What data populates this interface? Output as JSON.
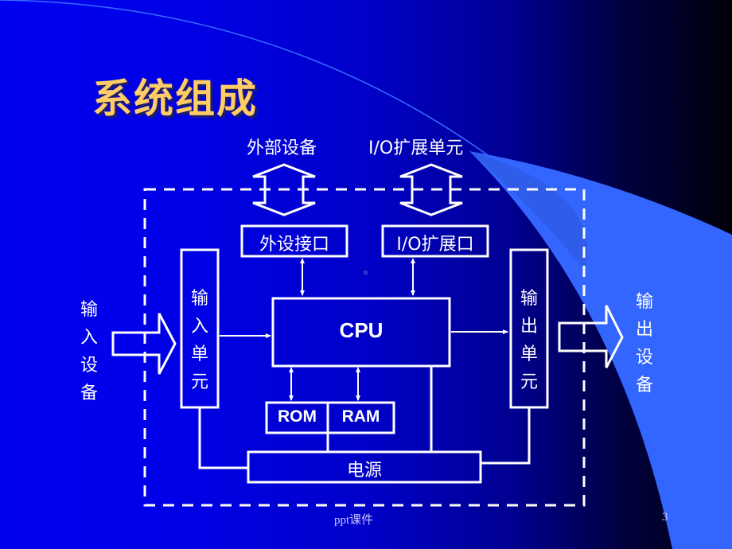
{
  "slide": {
    "title": "系统组成",
    "footer": "ppt课件",
    "page_number": "3",
    "colors": {
      "title": "#ffcc66",
      "line": "#ffffff",
      "accent_shape": "#3366ff"
    }
  },
  "diagram": {
    "top_labels": {
      "peripheral": "外部设备",
      "io_expansion_unit": "I/O扩展单元"
    },
    "boxes": {
      "peripheral_interface": "外设接口",
      "io_expansion_port": "I/O扩展口",
      "cpu": "CPU",
      "rom": "ROM",
      "ram": "RAM",
      "power": "电源",
      "input_unit": [
        "输",
        "入",
        "单",
        "元"
      ],
      "output_unit": [
        "输",
        "出",
        "单",
        "元"
      ]
    },
    "side_labels": {
      "input_device": [
        "输",
        "入",
        "设",
        "备"
      ],
      "output_device": [
        "输",
        "出",
        "设",
        "备"
      ]
    }
  }
}
